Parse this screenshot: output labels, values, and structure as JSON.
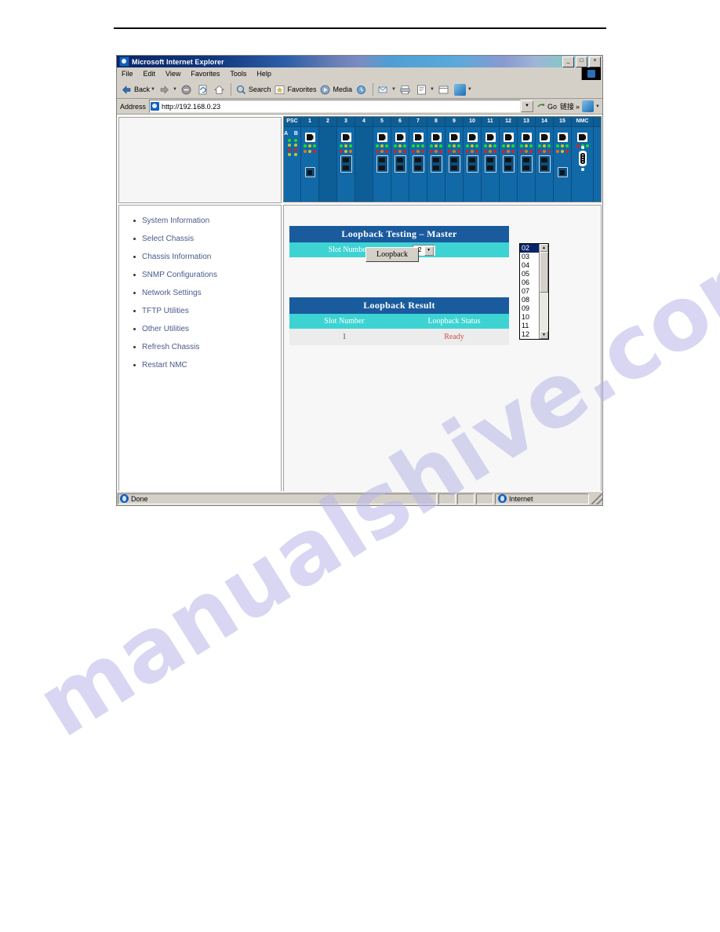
{
  "browser": {
    "title": "Microsoft Internet Explorer",
    "window_buttons": {
      "minimize": "_",
      "maximize": "□",
      "close": "×"
    },
    "menu": [
      "File",
      "Edit",
      "View",
      "Favorites",
      "Tools",
      "Help"
    ],
    "toolbar": {
      "back": "Back",
      "forward": "",
      "stop": "",
      "refresh": "",
      "home": "",
      "search": "Search",
      "favorites": "Favorites",
      "media": "Media",
      "history": "",
      "mail": "",
      "print": "",
      "edit": "",
      "discuss": "",
      "messenger": ""
    },
    "address": {
      "label": "Address",
      "value": "http://192.168.0.23",
      "go_label": "Go",
      "links_label": "链接",
      "links_chevron": "»"
    },
    "status": {
      "message": "Done",
      "zone": "Internet"
    }
  },
  "chassis": {
    "slot_labels": [
      "PSC",
      "1",
      "2",
      "3",
      "4",
      "5",
      "6",
      "7",
      "8",
      "9",
      "10",
      "11",
      "12",
      "13",
      "14",
      "15",
      "NMC"
    ],
    "psc_feed_labels": "A B"
  },
  "sidebar": {
    "items": [
      {
        "label": "System Information"
      },
      {
        "label": "Select Chassis"
      },
      {
        "label": "Chassis Information"
      },
      {
        "label": "SNMP Configurations"
      },
      {
        "label": "Network Settings"
      },
      {
        "label": "TFTP Utilities"
      },
      {
        "label": "Other Utilities"
      },
      {
        "label": "Refresh Chassis"
      },
      {
        "label": "Restart NMC"
      }
    ]
  },
  "main": {
    "testing_table": {
      "title": "Loopback Testing – Master",
      "slot_number_label": "Slot Number",
      "selected_slot": "02",
      "button_label": "Loopback"
    },
    "dropdown": {
      "selected": "02",
      "options": [
        "02",
        "03",
        "04",
        "05",
        "06",
        "07",
        "08",
        "09",
        "10",
        "11",
        "12"
      ],
      "up_arrow": "▲",
      "down_arrow": "▼"
    },
    "result_table": {
      "title": "Loopback Result",
      "columns": [
        "Slot Number",
        "Loopback Status"
      ],
      "rows": [
        {
          "slot_number": "1",
          "status": "Ready"
        }
      ]
    }
  },
  "watermark": {
    "text": "manualshive.com"
  },
  "colors": {
    "header_blue": "#1a5b9e",
    "row_cyan": "#3ed3d3",
    "chassis_blue": "#1169a8",
    "status_red": "#c85050",
    "link_blue": "#4a5a8c"
  }
}
